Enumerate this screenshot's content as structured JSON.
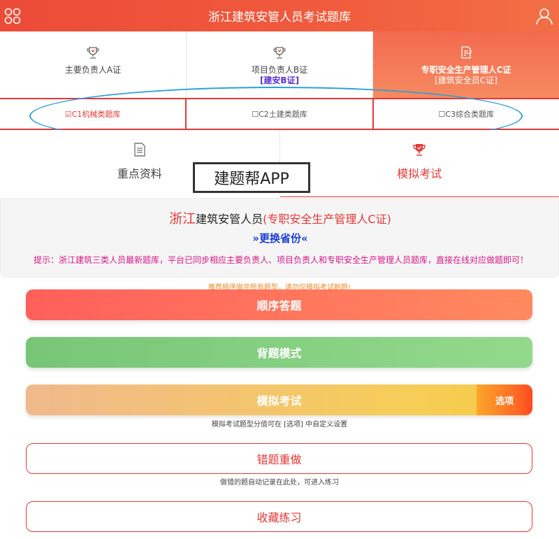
{
  "header": {
    "title": "浙江建筑安管人员考试题库",
    "colors": {
      "bar_start": "#ec4b37",
      "bar_end": "#f26f45"
    }
  },
  "cert_tabs": [
    {
      "label": "主要负责人A证",
      "sub": "",
      "icon": "trophy-icon",
      "active": false
    },
    {
      "label": "项目负责人B证",
      "sub": "[建安B证]",
      "icon": "trophy-icon",
      "active": false
    },
    {
      "label": "专职安全生产管理人C证",
      "sub": "[建筑安全员C证]",
      "icon": "document-edit-icon",
      "active": true
    }
  ],
  "categories": [
    {
      "label": "☑C1机械类题库",
      "active": true
    },
    {
      "label": "☐C2土建类题库",
      "active": false
    },
    {
      "label": "☐C3综合类题库",
      "active": false
    }
  ],
  "modes": [
    {
      "label": "重点资料",
      "icon": "document-icon",
      "active": false
    },
    {
      "label": "模拟考试",
      "icon": "trophy-icon",
      "active": true
    }
  ],
  "watermark": "建题帮APP",
  "info": {
    "province": "浙江",
    "role": "建筑安管人员",
    "cert": "(专职安全生产管理人C证)",
    "switch": "»更换省份«",
    "tip": "提示：浙江建筑三类人员最新题库，平台已同步相应主要负责人、项目负责人和专职安全生产管理人员题库，直接在线对应做题即可！"
  },
  "recommend_note": "推荐顺序做完所有题型，请勿仅模拟考试刷题!",
  "buttons": {
    "sequential": "顺序答题",
    "recite": "背题模式",
    "mock_exam": "模拟考试",
    "options": "选项",
    "mock_note": "模拟考试题型分值可在 [选项] 中自定义设置",
    "wrong": "错题重做",
    "wrong_note": "做错的题自动记录在此处，可进入练习",
    "favorites": "收藏练习"
  },
  "accent": "#e53935"
}
